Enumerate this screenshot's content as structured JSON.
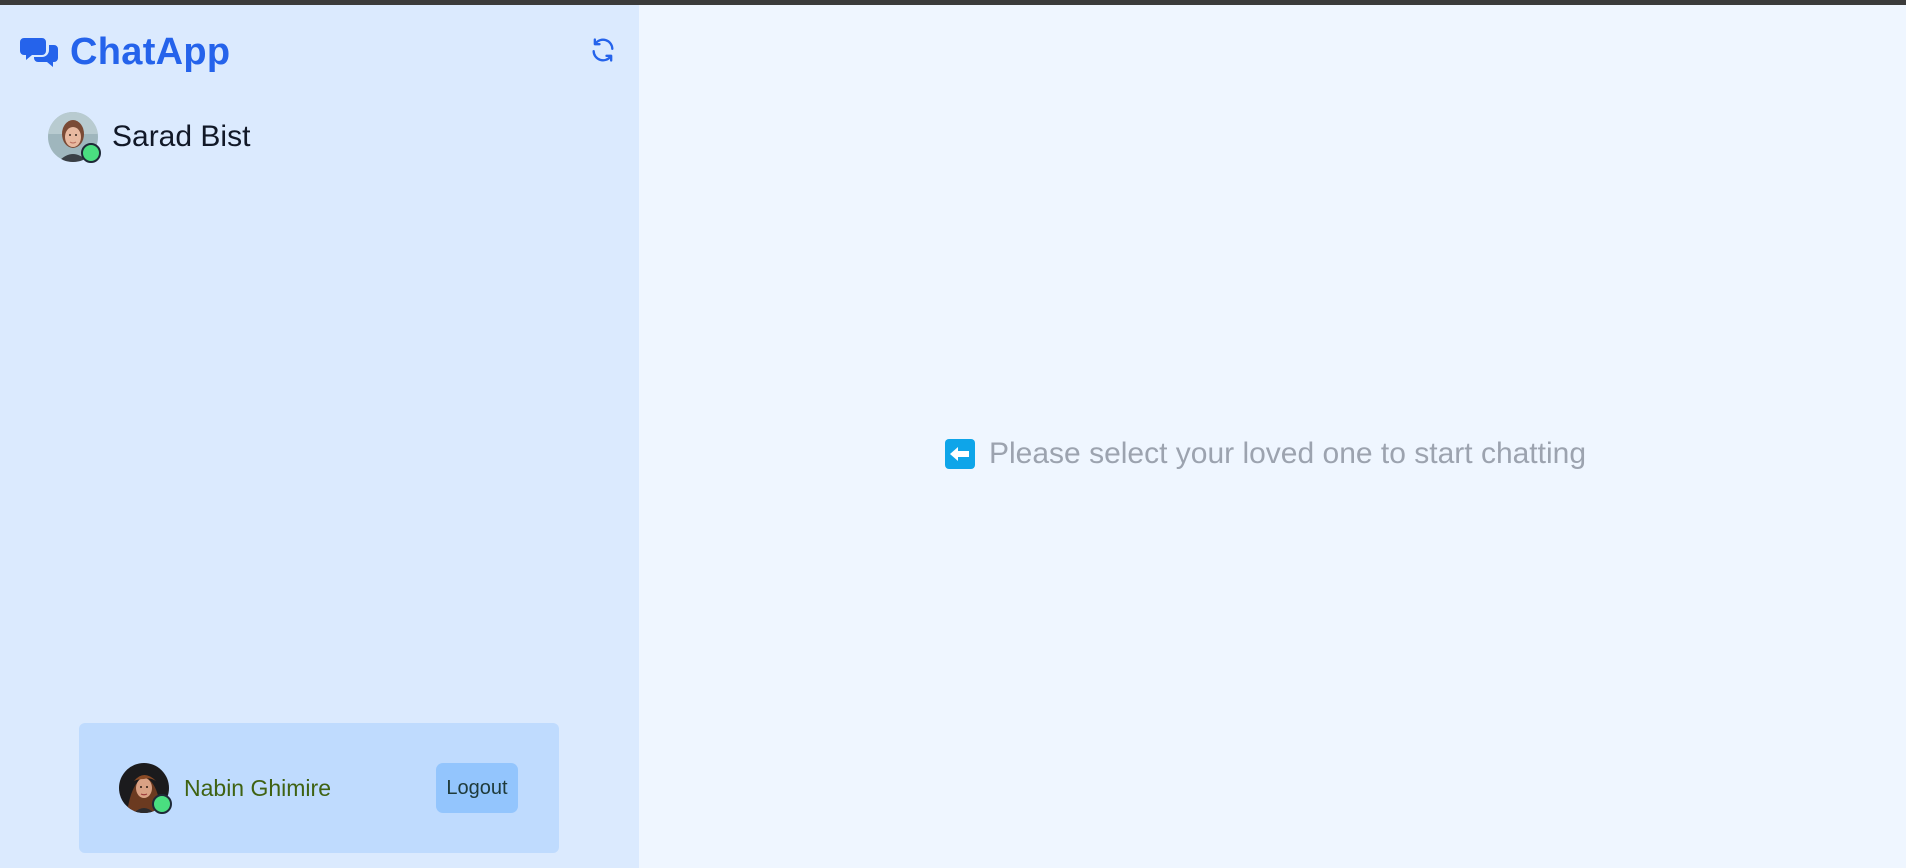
{
  "app": {
    "title": "ChatApp",
    "brand_icon": "chat-bubbles-icon",
    "brand_color": "#2563eb",
    "refresh_icon": "refresh-icon"
  },
  "sidebar": {
    "contacts": [
      {
        "name": "Sarad Bist",
        "online": true,
        "status_color": "#4ade80"
      }
    ]
  },
  "current_user": {
    "name": "Nabin Ghimire",
    "online": true,
    "logout_label": "Logout"
  },
  "main": {
    "empty_message": "Please select your loved one to start chatting",
    "empty_icon": "arrow-left-square-icon",
    "accent": "#0ea5e9"
  }
}
